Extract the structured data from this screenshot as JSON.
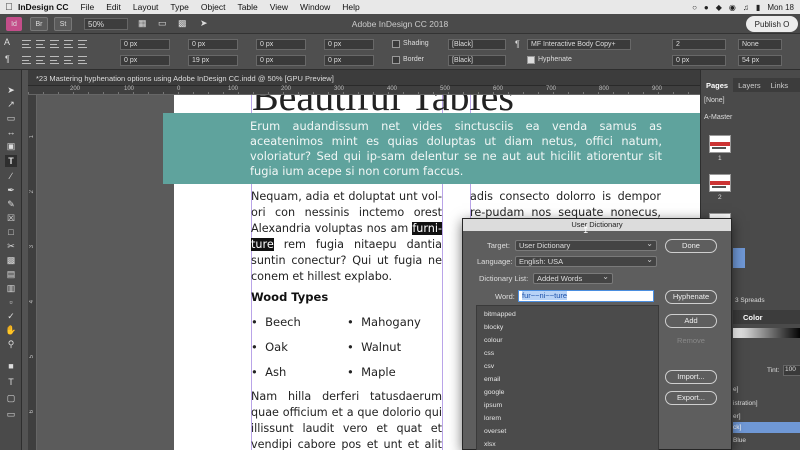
{
  "menubar": {
    "app_name": "InDesign CC",
    "items": [
      "File",
      "Edit",
      "Layout",
      "Type",
      "Object",
      "Table",
      "View",
      "Window",
      "Help"
    ],
    "clock": "Mon 18"
  },
  "appbar": {
    "br_label": "Br",
    "st_label": "St",
    "zoom": "50%",
    "window_title": "Adobe InDesign CC 2018",
    "publish_label": "Publish O"
  },
  "control": {
    "fields": [
      "0 px",
      "0 px",
      "0 px",
      "19 px",
      "0 px",
      "0 px",
      "0 px",
      "0 px"
    ],
    "shading_label": "Shading",
    "border_label": "Border",
    "color_a": "[Black]",
    "color_b": "[Black]",
    "paragraph_style": "MF Interactive Body Copy+",
    "hyphenate_label": "Hyphenate",
    "drop_cap_lines": "2",
    "none_label": "None",
    "size_a": "0 px",
    "size_b": "54 px",
    "coord_readout": "326.451 px"
  },
  "doc": {
    "tab_title": "*23 Mastering hyphenation options using Adobe InDesign CC.indd @ 50% [GPU Preview]",
    "ruler_numbers": [
      "200",
      "100",
      "0",
      "100",
      "200",
      "300",
      "400",
      "500",
      "600",
      "700",
      "800",
      "900"
    ],
    "vruler_numbers": [
      "1",
      "2",
      "3",
      "4",
      "5",
      "6"
    ]
  },
  "page": {
    "title": "Beautiful Tables",
    "teal_text": "Erum audandissum net vides sinctusciis ea venda samus as aceatenimos mint es quias doluptas ut diam netus, offici natum, voloriatur? Sed qui ip-sam delentur se ne aut aut hicilit atiorentur sit fugia ium acepe si non corum faccus.",
    "col1_before": "Nequam, adia et doluptat unt vol-ori con nessinis inctemo orest Alexandria voluptas nos am ",
    "col1_hl1": "furni-",
    "col1_hl2": "ture",
    "col1_after": " rem fugia nitaepu dantia suntin conectur? Qui ut fugia ne conem et hillest explabo.",
    "col2_text": "adis consecto dolorro is dempor re-pudam nos sequate nonecus, quiatur",
    "wood_heading": "Wood Types",
    "wood_items": [
      "Beech",
      "Mahogany",
      "Oak",
      "Walnut",
      "Ash",
      "Maple"
    ],
    "col3_text": "Nam hilla derferi tatusdaerum quae officium et a que dolorio qui illissunt laudit vero et quat et vendipi cabore pos et unt et alit unt acidit"
  },
  "right_panel": {
    "tabs": [
      "Pages",
      "Layers",
      "Links"
    ],
    "none_item": "[None]",
    "master_item": "A-Master",
    "page_numbers": [
      "1",
      "2",
      "3"
    ],
    "spreads_label": "3 Spreads",
    "color_tab": "Color",
    "tint_label": "Tint:",
    "tint_value": "100",
    "swatch_items": [
      "e]",
      "istration]",
      "er]",
      "ck]",
      "Blue"
    ]
  },
  "dialog": {
    "title": "User Dictionary",
    "target_label": "Target:",
    "target_value": "User Dictionary",
    "language_label": "Language:",
    "language_value": "English: USA",
    "list_label": "Dictionary List:",
    "list_value": "Added Words",
    "word_label": "Word:",
    "word_value": "fur~~ni~~ture",
    "words": [
      "bitmapped",
      "blocky",
      "colour",
      "css",
      "csv",
      "email",
      "google",
      "ipsum",
      "lorem",
      "overset",
      "xlsx"
    ],
    "buttons": {
      "done": "Done",
      "hyphenate": "Hyphenate",
      "add": "Add",
      "remove": "Remove",
      "import": "Import...",
      "export": "Export..."
    }
  }
}
